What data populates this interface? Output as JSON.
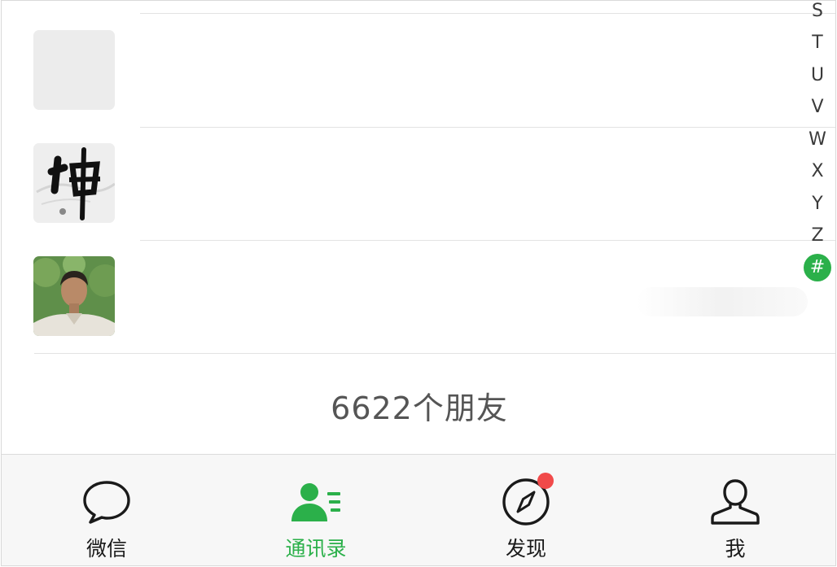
{
  "contacts": [
    {
      "avatar": "placeholder-avatar",
      "name": ""
    },
    {
      "avatar": "calligraphy-fo-avatar",
      "name": ""
    },
    {
      "avatar": "man-photo-avatar",
      "name": ""
    }
  ],
  "index_letters": [
    "S",
    "T",
    "U",
    "V",
    "W",
    "X",
    "Y",
    "Z",
    "#"
  ],
  "active_index": "#",
  "friend_count_text": "6622个朋友",
  "tabs": [
    {
      "label": "微信",
      "icon": "chat-bubble-icon"
    },
    {
      "label": "通讯录",
      "icon": "contacts-icon"
    },
    {
      "label": "发现",
      "icon": "compass-icon",
      "badge": "red-dot"
    },
    {
      "label": "我",
      "icon": "person-icon"
    }
  ],
  "active_tab": "通讯录",
  "colors": {
    "accent": "#2bb04a",
    "badge": "#f14a4a",
    "tabbar_bg": "#f7f7f7"
  }
}
